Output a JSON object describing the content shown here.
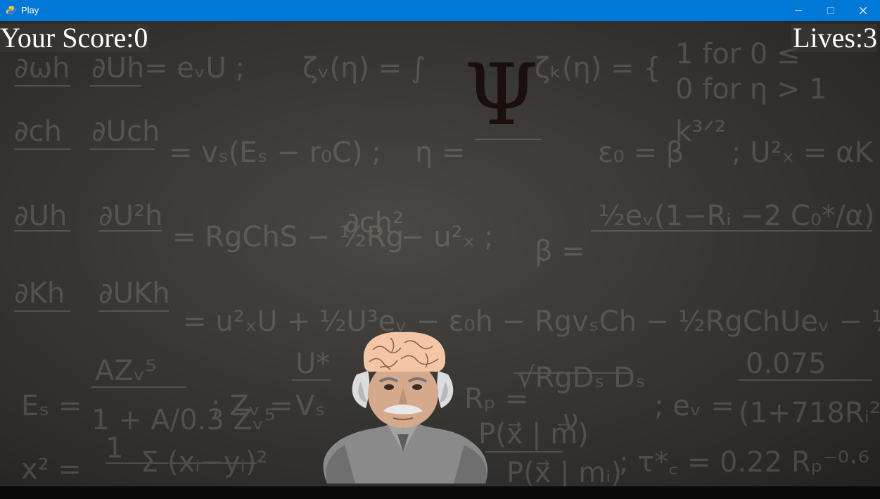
{
  "window": {
    "title": "Play",
    "app_icon": "pygame-snake-icon",
    "controls": {
      "minimize": "minimize-icon",
      "maximize": "maximize-icon",
      "close": "close-icon"
    }
  },
  "hud": {
    "score_text": "Your Score:0",
    "lives_text": "Lives:3"
  },
  "falling_object": {
    "symbol": "Ψ",
    "color": "#1a0f0c"
  },
  "player": {
    "sprite": "einstein-with-brain-head"
  },
  "colors": {
    "titlebar": "#0078d7",
    "hud_text": "#ffffff",
    "chalkboard": "#3b3936"
  }
}
